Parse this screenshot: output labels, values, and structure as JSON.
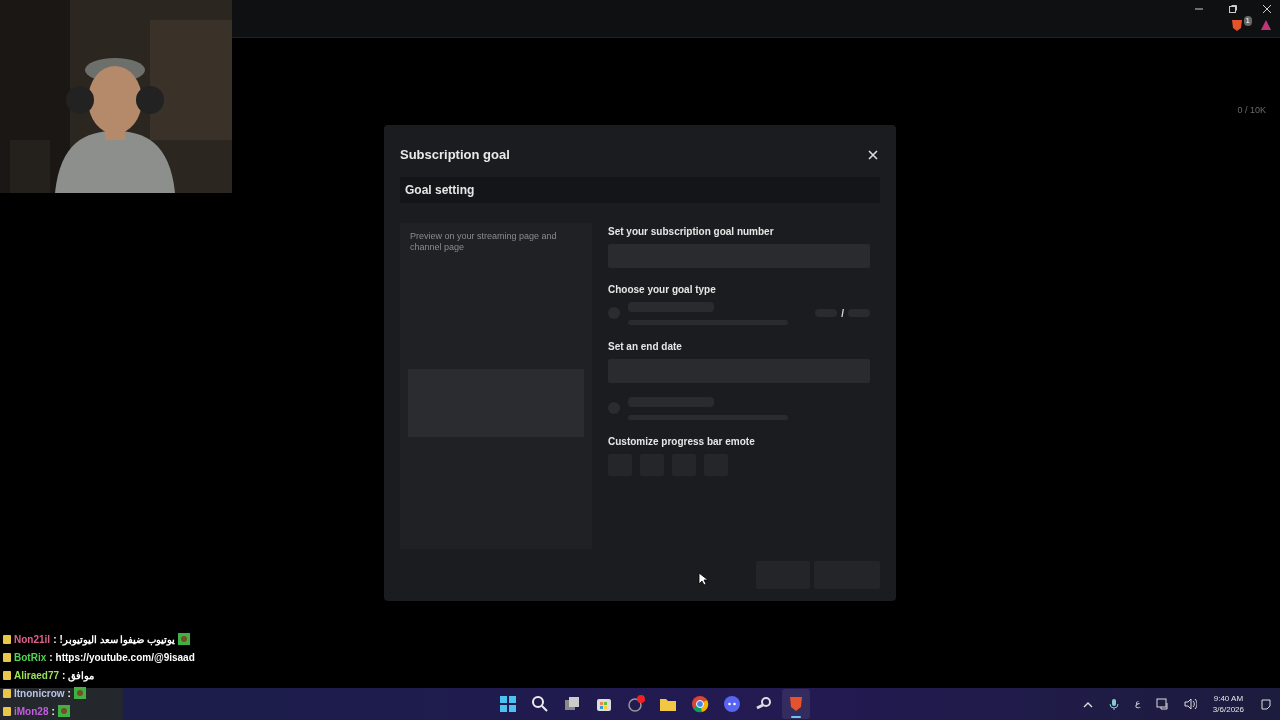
{
  "browser": {
    "goal_counter": "0 / 10K",
    "extension_badge": "1"
  },
  "modal": {
    "title": "Subscription goal",
    "tabs": [
      {
        "label": "Goal setting",
        "selected": true
      }
    ],
    "preview_caption": "Preview on your streaming page and channel page",
    "fields": [
      {
        "kind": "input",
        "label": "Set your subscription goal number"
      },
      {
        "kind": "radio",
        "label": "Choose your goal type",
        "separator": "/",
        "selected": false
      },
      {
        "kind": "input_radio",
        "label": "Set an end date",
        "selected": false
      },
      {
        "kind": "emotes",
        "label": "Customize progress bar emote"
      }
    ]
  },
  "chat": [
    {
      "user": "Non21il",
      "color": "#e0608c",
      "separator": ":",
      "text": "يوتيوب ضيفوا سعد اليوتيوبر!",
      "kind": "text_emote"
    },
    {
      "user": "BotRix",
      "color": "#52d452",
      "separator": ":",
      "text": "https://youtube.com/@9isaad",
      "kind": "text"
    },
    {
      "user": "Aliraed77",
      "color": "#9be05a",
      "separator": ":",
      "text": "موافق",
      "kind": "text"
    },
    {
      "user": "Itnonicrow",
      "color": "#b8c4e6",
      "separator": ":",
      "kind": "emote"
    },
    {
      "user": "iMon28",
      "color": "#c25ee0",
      "separator": ":",
      "kind": "emote"
    }
  ],
  "taskbar": {
    "apps": [
      {
        "kind": "start",
        "active": false
      },
      {
        "kind": "search",
        "active": false
      },
      {
        "kind": "taskview",
        "active": false
      },
      {
        "kind": "store",
        "active": false
      },
      {
        "kind": "notify",
        "active": false
      },
      {
        "kind": "folder",
        "active": false
      },
      {
        "kind": "browser",
        "active": false
      },
      {
        "kind": "chat",
        "active": false
      },
      {
        "kind": "steam",
        "active": false
      },
      {
        "kind": "shield",
        "active": true
      }
    ],
    "language": "ع",
    "time": "9:40 AM",
    "date": "3/6/2026"
  }
}
